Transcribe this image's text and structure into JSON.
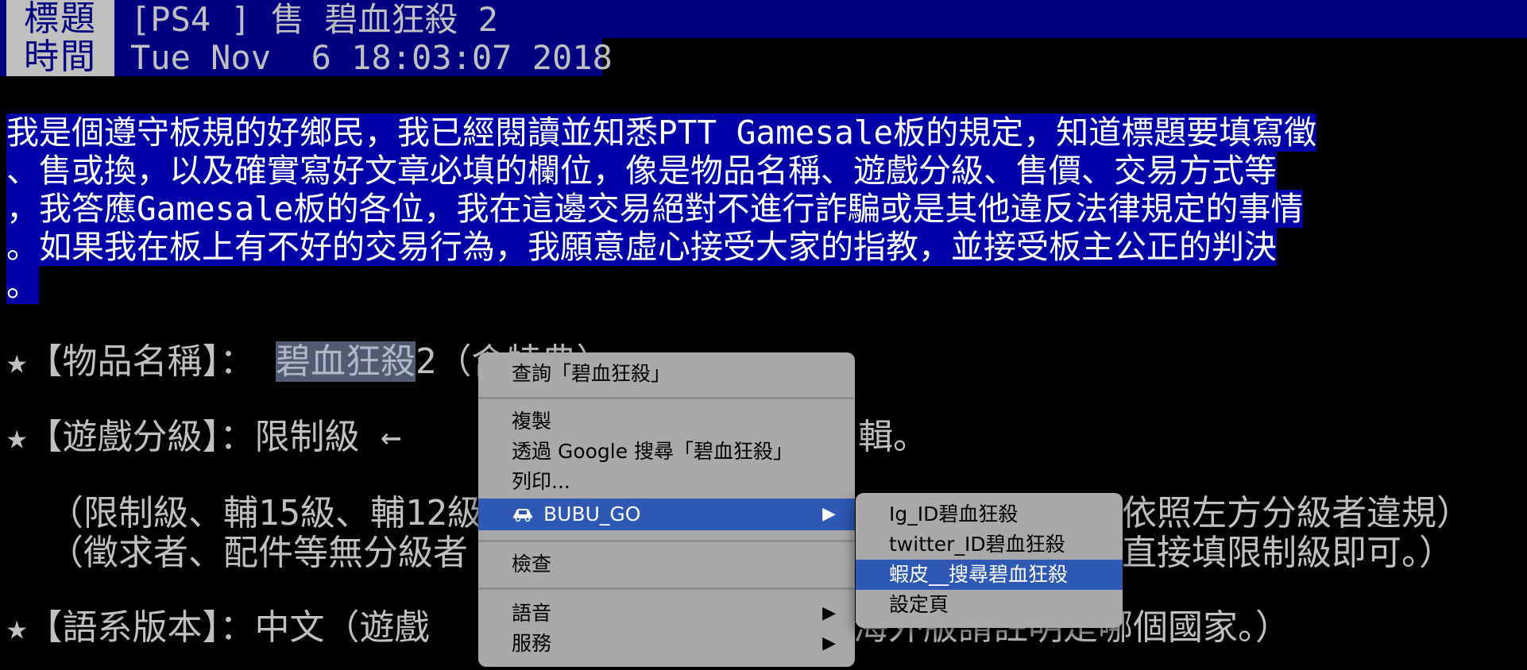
{
  "header": {
    "title_label": "標題",
    "title_value": "[PS4 ] 售 碧血狂殺 2",
    "time_label": "時間",
    "time_value": "Tue Nov  6 18:03:07 2018"
  },
  "declaration": {
    "lines": [
      "我是個遵守板規的好鄉民，我已經閱讀並知悉PTT Gamesale板的規定，知道標題要填寫徵",
      "、售或換，以及確實寫好文章必填的欄位，像是物品名稱、遊戲分級、售價、交易方式等",
      "，我答應Gamesale板的各位，我在這邊交易絕對不進行詐騙或是其他違反法律規定的事情",
      "。如果我在板上有不好的交易行為，我願意虛心接受大家的指教，並接受板主公正的判決",
      "。"
    ]
  },
  "fields": {
    "item_name_prefix": "★【物品名稱】： ",
    "item_name_selected": "碧血狂殺",
    "item_name_rest": "2（含特典）",
    "rating_prefix": "★【遊戲分級】：限制級 ←",
    "rating_rest": "輯。",
    "rating_note1_start": "  （限制級、輔15級、輔12級",
    "rating_note1_end": "依照左方分級者違規）",
    "rating_note2_start": "  （徵求者、配件等無分級者",
    "rating_note2_end": "直接填限制級即可。）",
    "language_prefix": "★【語系版本】：中文（遊戲",
    "language_rest": "海外版請註明是哪個國家。）"
  },
  "context_menu": {
    "lookup": "查詢「碧血狂殺」",
    "copy": "複製",
    "google_search": "透過 Google 搜尋「碧血狂殺」",
    "print": "列印...",
    "extension": "BUBU_GO",
    "inspect": "檢查",
    "speech": "語音",
    "services": "服務",
    "submenu_arrow": "▶"
  },
  "submenu": {
    "items": [
      "Ig_ID碧血狂殺",
      "twitter_ID碧血狂殺",
      "蝦皮__搜尋碧血狂殺",
      "設定頁"
    ]
  },
  "colors": {
    "terminal_bg": "#000000",
    "header_bg": "#000080",
    "selection_bg": "#0000a8",
    "menu_bg": "#a9a9a9",
    "menu_highlight": "#2d58b4"
  },
  "icons": {
    "extension_icon": "car-icon"
  }
}
